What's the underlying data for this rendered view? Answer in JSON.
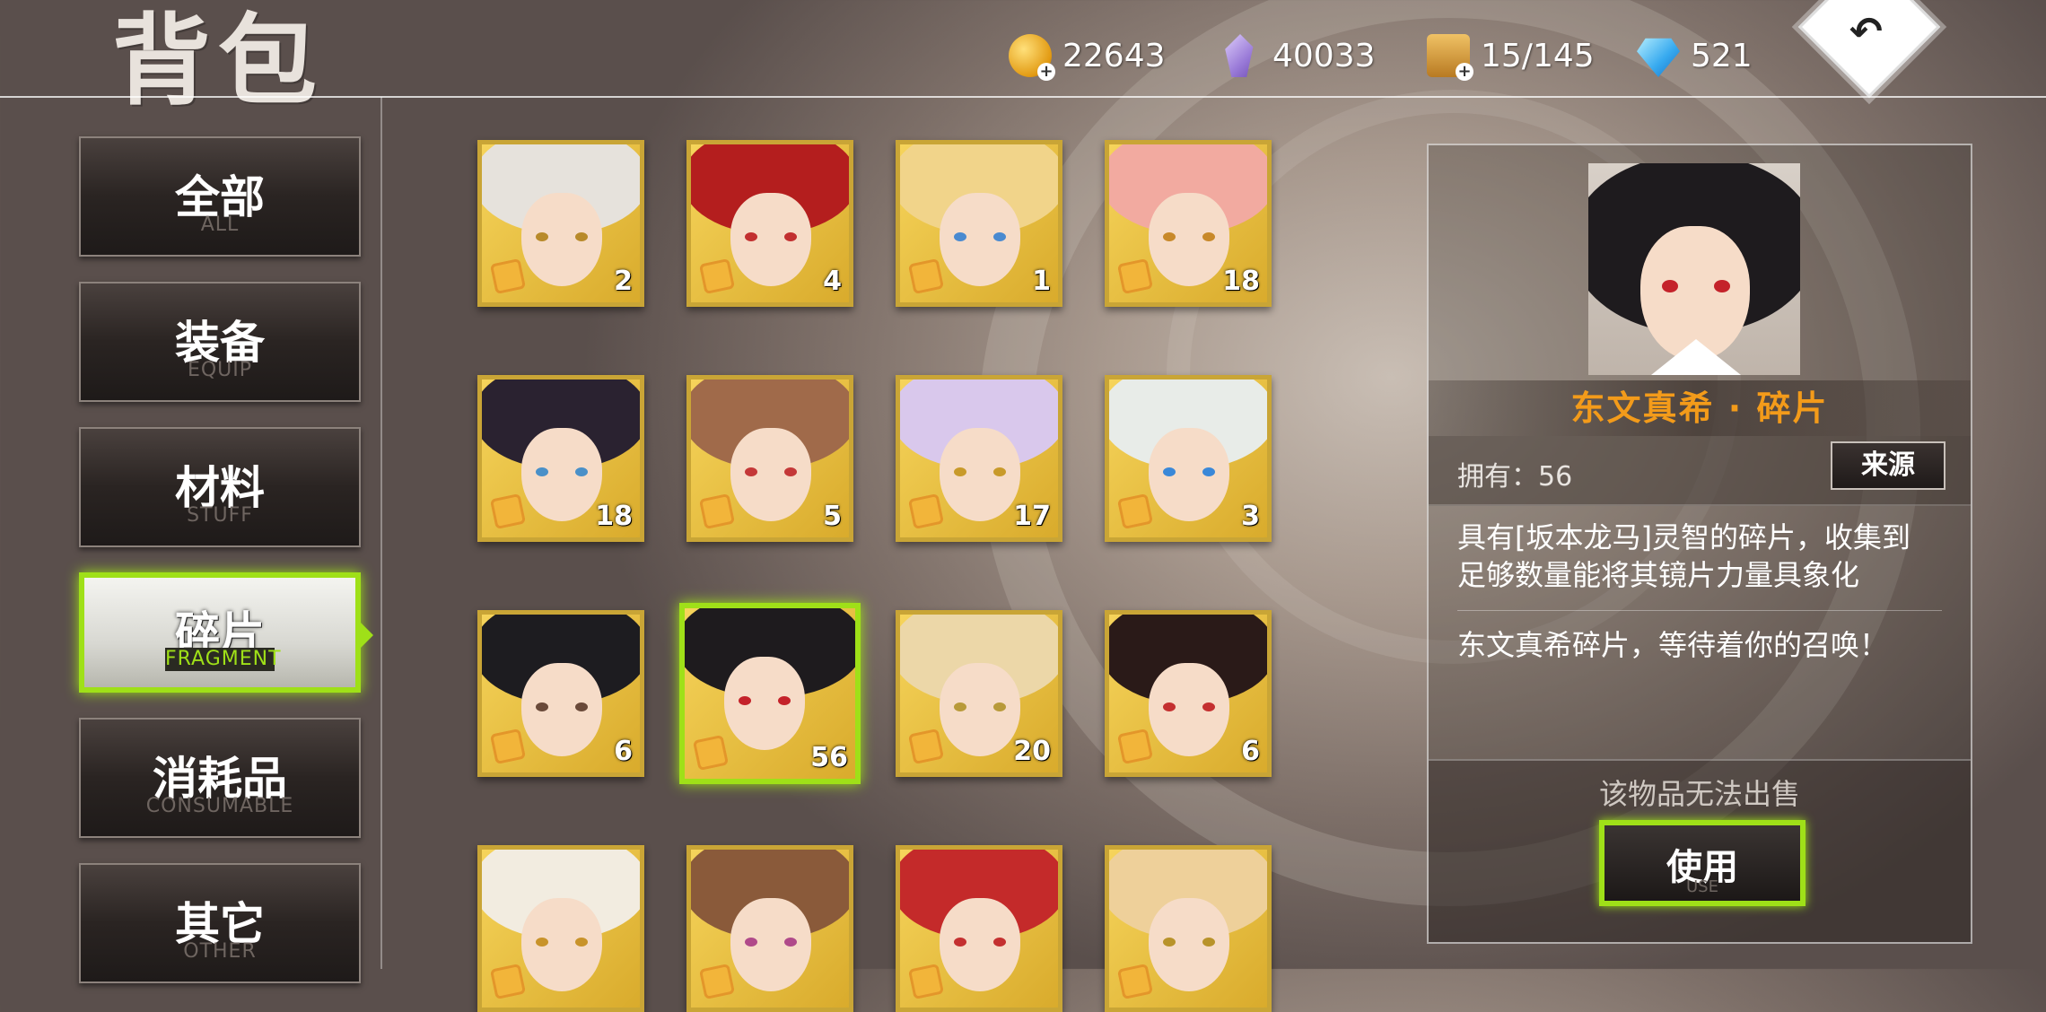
{
  "header": {
    "title": "背包",
    "resources": [
      {
        "icon": "gold-coin-icon",
        "value": "22643"
      },
      {
        "icon": "crystal-icon",
        "value": "40033"
      },
      {
        "icon": "chest-icon",
        "value": "15/145"
      },
      {
        "icon": "diamond-gem-icon",
        "value": "521"
      }
    ],
    "back_icon": "return-icon"
  },
  "sidebar": {
    "tabs": [
      {
        "cn": "全部",
        "en": "ALL"
      },
      {
        "cn": "装备",
        "en": "EQUIP"
      },
      {
        "cn": "材料",
        "en": "STUFF"
      },
      {
        "cn": "碎片",
        "en": "FRAGMENT",
        "active": true
      },
      {
        "cn": "消耗品",
        "en": "CONSUMABLE"
      },
      {
        "cn": "其它",
        "en": "OTHER"
      }
    ]
  },
  "grid": {
    "items": [
      {
        "count": "2",
        "hair": "#e6e2dc",
        "eye": "#b88a2a"
      },
      {
        "count": "4",
        "hair": "#b41e1e",
        "eye": "#c23030"
      },
      {
        "count": "1",
        "hair": "#f1d48a",
        "eye": "#4a8ad0"
      },
      {
        "count": "18",
        "hair": "#f2aaa0",
        "eye": "#c8892a"
      },
      {
        "count": "18",
        "hair": "#2a2230",
        "eye": "#4a90c8"
      },
      {
        "count": "5",
        "hair": "#a06a4a",
        "eye": "#c43838"
      },
      {
        "count": "17",
        "hair": "#d9c8ec",
        "eye": "#c89a2a"
      },
      {
        "count": "3",
        "hair": "#e8ece8",
        "eye": "#3a88d8"
      },
      {
        "count": "6",
        "hair": "#1d1c20",
        "eye": "#6a4a3a"
      },
      {
        "count": "56",
        "hair": "#1e1b1e",
        "eye": "#c4222a",
        "selected": true
      },
      {
        "count": "20",
        "hair": "#ecd7a8",
        "eye": "#b89a3a"
      },
      {
        "count": "6",
        "hair": "#2a1a18",
        "eye": "#c43030"
      },
      {
        "count": "",
        "hair": "#f2ece0",
        "eye": "#c8932a"
      },
      {
        "count": "",
        "hair": "#8a5a3a",
        "eye": "#b04a8a"
      },
      {
        "count": "",
        "hair": "#c42a2a",
        "eye": "#c43030"
      },
      {
        "count": "",
        "hair": "#eed09a",
        "eye": "#b8932a"
      }
    ]
  },
  "detail": {
    "name": "东文真希 · 碎片",
    "own_label": "拥有：56",
    "source_button": "来源",
    "description_line1": "具有[坂本龙马]灵智的碎片，收集到",
    "description_line2": "足够数量能将其镜片力量具象化",
    "description2": "东文真希碎片，等待着你的召唤！",
    "not_sellable": "该物品无法出售",
    "use_button_cn": "使用",
    "use_button_en": "USE"
  },
  "colors": {
    "accent_green": "#9fe018",
    "name_orange": "#f39b1a",
    "frame_gold": "#c9a536"
  }
}
